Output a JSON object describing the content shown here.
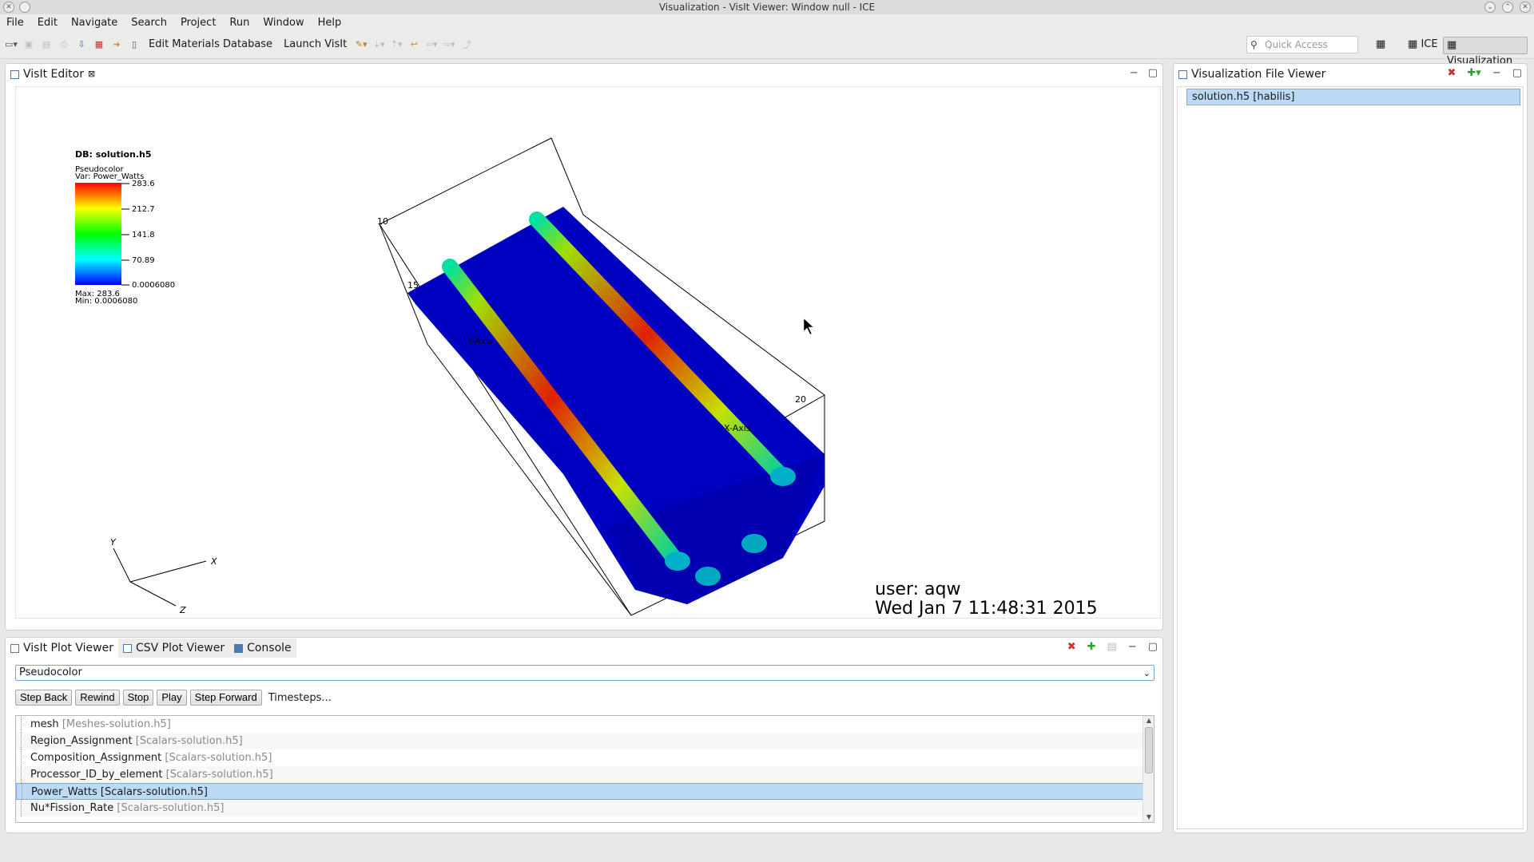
{
  "window": {
    "title": "Visualization - VisIt Viewer: Window null - ICE"
  },
  "menu": [
    "File",
    "Edit",
    "Navigate",
    "Search",
    "Project",
    "Run",
    "Window",
    "Help"
  ],
  "toolbar": {
    "edit_materials": "Edit Materials Database",
    "launch_visit": "Launch VisIt",
    "quick_access_placeholder": "Quick Access",
    "perspective_ice": "ICE",
    "perspective_visualization": "Visualization"
  },
  "visit_editor": {
    "tab_label": "VisIt Editor",
    "db_label": "DB: solution.h5",
    "legend": {
      "plot_type": "Pseudocolor",
      "var_label": "Var: Power_Watts",
      "ticks": [
        "283.6",
        "212.7",
        "141.8",
        "70.89",
        "0.0006080"
      ],
      "max_label": "Max:  283.6",
      "min_label": "Min:  0.0006080",
      "colors": [
        "#ff0000",
        "#ffff00",
        "#00ff00",
        "#00ffff",
        "#0000ff"
      ]
    },
    "triad": {
      "x": "X",
      "y": "Y",
      "z": "Z"
    },
    "user_label": "user: aqw",
    "date_label": "Wed Jan  7 11:48:31 2015",
    "axis_labels": {
      "x_title": "X-Axis",
      "y_title": "Y-Axis",
      "tick_10": "10",
      "tick_15": "15",
      "tick_20": "20"
    }
  },
  "file_viewer": {
    "tab_label": "Visualization File Viewer",
    "items": [
      {
        "label": "solution.h5 [habilis]"
      }
    ]
  },
  "bottom_panel": {
    "tabs": [
      "VisIt Plot Viewer",
      "CSV Plot Viewer",
      "Console"
    ],
    "plot_type": "Pseudocolor",
    "buttons": {
      "step_back": "Step Back",
      "rewind": "Rewind",
      "stop": "Stop",
      "play": "Play",
      "step_forward": "Step Forward",
      "timesteps": "Timesteps..."
    },
    "variables": [
      {
        "name": "mesh",
        "source": "[Meshes-solution.h5]"
      },
      {
        "name": "Region_Assignment",
        "source": "[Scalars-solution.h5]"
      },
      {
        "name": "Composition_Assignment",
        "source": "[Scalars-solution.h5]"
      },
      {
        "name": "Processor_ID_by_element",
        "source": "[Scalars-solution.h5]"
      },
      {
        "name": "Power_Watts",
        "source": "[Scalars-solution.h5]"
      },
      {
        "name": "Nu*Fission_Rate",
        "source": "[Scalars-solution.h5]"
      }
    ]
  }
}
